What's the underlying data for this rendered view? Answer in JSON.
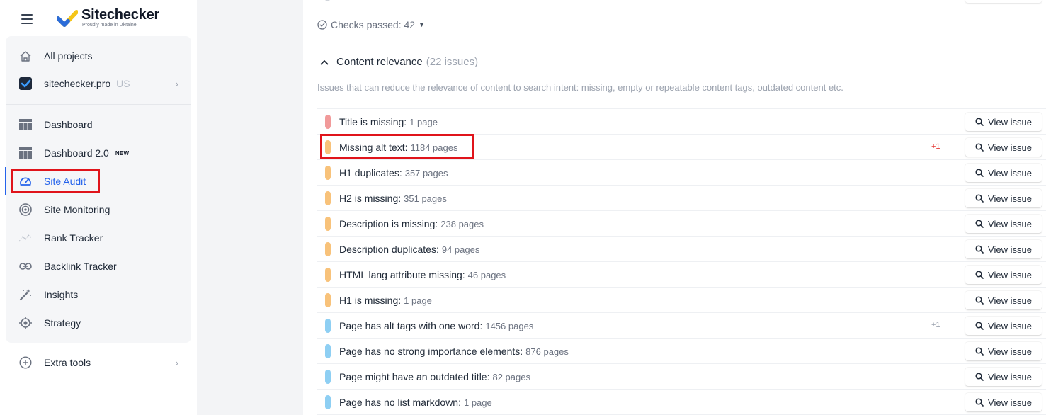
{
  "brand": {
    "name": "Sitechecker",
    "tagline": "Proudly made in Ukraine",
    "colors": {
      "blue": "#2b6cd9",
      "yellow": "#f5c518"
    }
  },
  "sidebar": {
    "top_items": [
      {
        "label": "All projects",
        "icon": "home-icon"
      },
      {
        "label": "sitechecker.pro",
        "suffix": "US",
        "icon": "project-favicon-icon"
      }
    ],
    "items": [
      {
        "label": "Dashboard",
        "icon": "table-icon"
      },
      {
        "label": "Dashboard 2.0",
        "badge": "NEW",
        "icon": "table-icon"
      },
      {
        "label": "Site Audit",
        "icon": "gauge-icon",
        "active": true
      },
      {
        "label": "Site Monitoring",
        "icon": "radar-icon"
      },
      {
        "label": "Rank Tracker",
        "icon": "trend-icon"
      },
      {
        "label": "Backlink Tracker",
        "icon": "link-icon"
      },
      {
        "label": "Insights",
        "icon": "magic-wand-icon"
      },
      {
        "label": "Strategy",
        "icon": "target-icon"
      }
    ],
    "extra": {
      "label": "Extra tools",
      "icon": "plus-circle-icon"
    }
  },
  "audit": {
    "checks_passed": "Checks passed: 42",
    "section": {
      "title": "Content relevance",
      "count": "(22 issues)",
      "description": "Issues that can reduce the relevance of content to search intent: missing, empty or repeatable content tags, outdated content etc."
    },
    "view_label": "View issue",
    "colors": {
      "critical": "#f19a9a",
      "warning": "#f8c27a",
      "notice": "#8ecff3"
    },
    "issues": [
      {
        "title": "Title is missing:",
        "count": "1 page",
        "severity": "critical",
        "delta": ""
      },
      {
        "title": "Missing alt text:",
        "count": "1184 pages",
        "severity": "warning",
        "delta": "+1",
        "delta_color": "#e53935"
      },
      {
        "title": "H1 duplicates:",
        "count": "357 pages",
        "severity": "warning",
        "delta": ""
      },
      {
        "title": "H2 is missing:",
        "count": "351 pages",
        "severity": "warning",
        "delta": ""
      },
      {
        "title": "Description is missing:",
        "count": "238 pages",
        "severity": "warning",
        "delta": ""
      },
      {
        "title": "Description duplicates:",
        "count": "94 pages",
        "severity": "warning",
        "delta": ""
      },
      {
        "title": "HTML lang attribute missing:",
        "count": "46 pages",
        "severity": "warning",
        "delta": ""
      },
      {
        "title": "H1 is missing:",
        "count": "1 page",
        "severity": "warning",
        "delta": ""
      },
      {
        "title": "Page has alt tags with one word:",
        "count": "1456 pages",
        "severity": "notice",
        "delta": "+1",
        "delta_color": "#9ca3af"
      },
      {
        "title": "Page has no strong importance elements:",
        "count": "876 pages",
        "severity": "notice",
        "delta": ""
      },
      {
        "title": "Page might have an outdated title:",
        "count": "82 pages",
        "severity": "notice",
        "delta": ""
      },
      {
        "title": "Page has no list markdown:",
        "count": "1 page",
        "severity": "notice",
        "delta": ""
      }
    ]
  }
}
